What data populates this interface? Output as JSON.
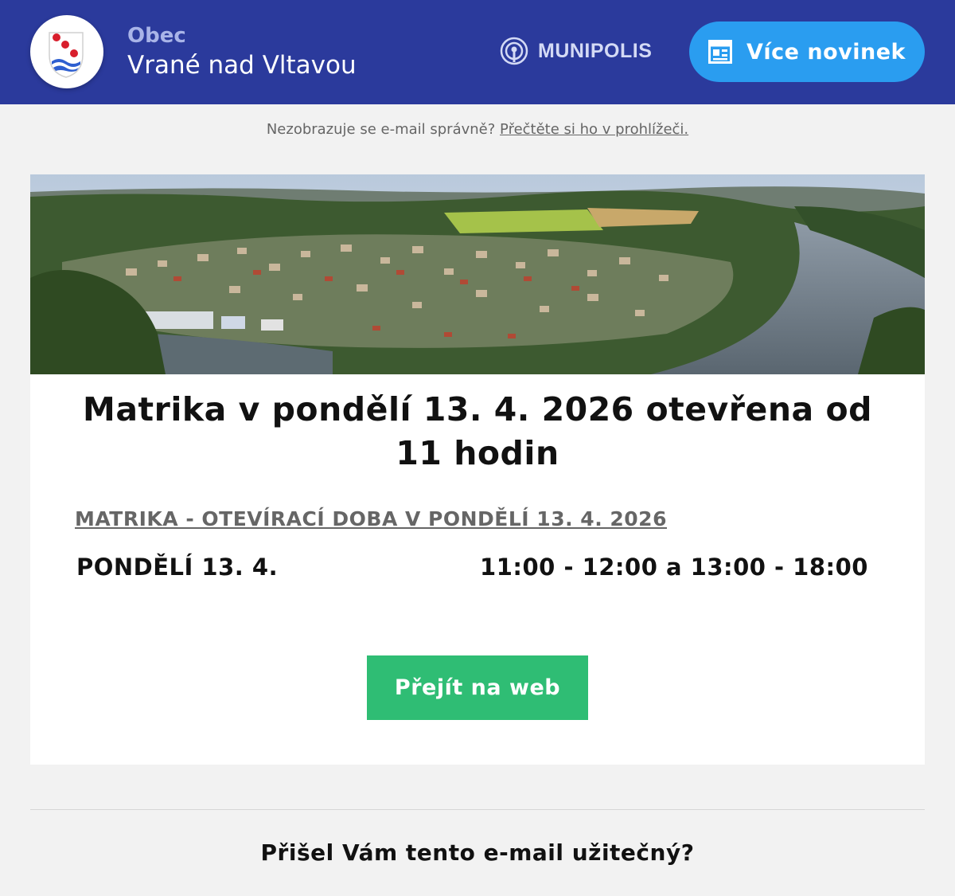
{
  "header": {
    "org_kind": "Obec",
    "org_name": "Vrané nad Vltavou",
    "brand_name": "MUNIPOLIS",
    "more_news_label": "Více novinek",
    "colors": {
      "background": "#2b3a9c",
      "button": "#2a9df0"
    }
  },
  "preheader": {
    "text": "Nezobrazuje se e-mail správně?",
    "link_label": "Přečtěte si ho v prohlížeči."
  },
  "article": {
    "title": "Matrika v pondělí 13. 4. 2026 otevřena od 11 hodin",
    "section_heading": "MATRIKA - OTEVÍRACÍ DOBA V PONDĚLÍ 13. 4. 2026",
    "hours": {
      "day": "PONDĚLÍ 13. 4.",
      "time": "11:00 - 12:00 a 13:00 - 18:00"
    },
    "cta_label": "Přejít na web",
    "cta_color": "#2fbd74"
  },
  "footer": {
    "feedback_question": "Přišel Vám tento e-mail užitečný?"
  },
  "icons": {
    "logo": "coat-of-arms-icon",
    "brand": "broadcast-icon",
    "news": "newspaper-icon"
  }
}
